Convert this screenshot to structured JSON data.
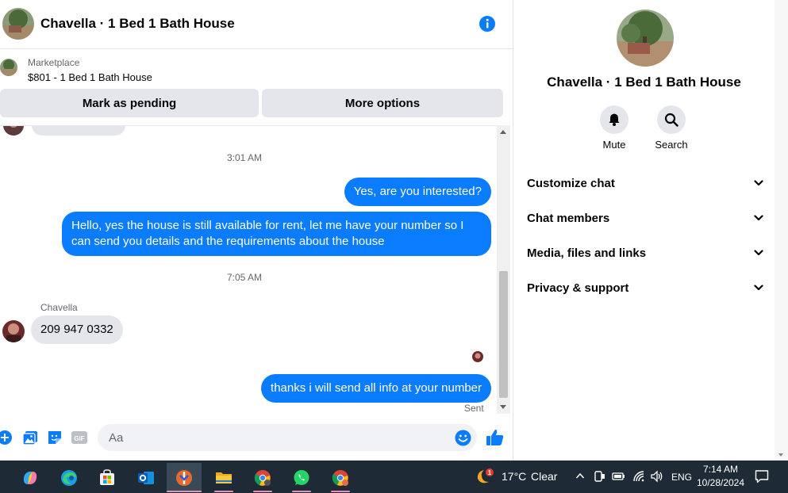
{
  "header": {
    "title": "Chavella · 1 Bed 1 Bath House"
  },
  "marketplace": {
    "label": "Marketplace",
    "title": "$801 - 1 Bed 1 Bath House"
  },
  "actions": {
    "pending_label": "Mark as pending",
    "more_label": "More options"
  },
  "thread": {
    "time_1": "3:01 AM",
    "msg_1": "Yes, are you interested?",
    "msg_2": "Hello, yes the house is still available for rent, let me have your number so I can send you details and the requirements about the house",
    "time_2": "7:05 AM",
    "sender": "Chavella",
    "msg_3": "209 947 0332",
    "msg_4": "thanks i will send all info at your number",
    "status": "Sent"
  },
  "composer": {
    "placeholder": "Aa"
  },
  "info_panel": {
    "name": "Chavella · 1 Bed 1 Bath House",
    "mute_label": "Mute",
    "search_label": "Search",
    "sections": [
      "Customize chat",
      "Chat members",
      "Media, files and links",
      "Privacy & support"
    ]
  },
  "taskbar": {
    "weather_badge": "1",
    "temperature": "17°C",
    "condition": "Clear",
    "language": "ENG",
    "time": "7:14 AM",
    "date": "10/28/2024"
  },
  "colors": {
    "accent": "#0a7cff",
    "incoming": "#e4e6eb",
    "taskbar": "#1e2b37"
  }
}
